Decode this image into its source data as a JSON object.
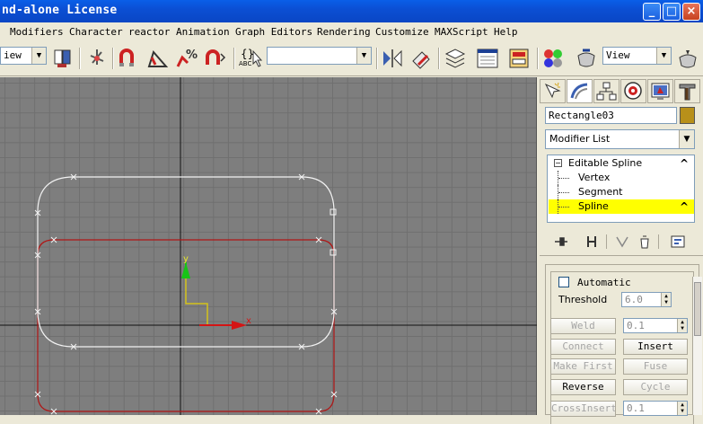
{
  "title_bar": {
    "title": "nd-alone License",
    "minimize_glyph": "_",
    "maximize_glyph": "□",
    "close_glyph": "×"
  },
  "menu": {
    "items": [
      "Modifiers",
      "Character",
      "reactor",
      "Animation",
      "Graph Editors",
      "Rendering",
      "Customize",
      "MAXScript",
      "Help"
    ]
  },
  "toolbar": {
    "view_dropdown_left": "iew",
    "selection_set_value": "",
    "view_dropdown_right": "View",
    "snap_label": "3",
    "named_sel_label": "{}",
    "named_sel_sub": "ABC"
  },
  "viewport": {
    "axis_x_label": "x",
    "axis_y_label": "y",
    "colors": {
      "background": "#7e7e7e",
      "grid": "#6f6f6f",
      "white_shape": "#f2f2f2",
      "red_shape": "#b01515",
      "axis_x": "#d41414",
      "axis_y": "#17c417",
      "gizmo": "#d4c21a"
    }
  },
  "command_panel": {
    "tabs": [
      "create-icon",
      "modify-icon",
      "hierarchy-icon",
      "motion-icon",
      "display-icon",
      "utilities-icon"
    ],
    "object_name": "Rectangle03",
    "object_color": "#b8901a",
    "modifier_list": "Modifier List",
    "stack": [
      {
        "label": "Editable Spline",
        "toggle": "−",
        "chevron": "^"
      },
      {
        "label": "Vertex"
      },
      {
        "label": "Segment"
      },
      {
        "label": "Spline",
        "selected": true,
        "chevron": "^"
      }
    ],
    "rollout": {
      "automatic_label": "Automatic",
      "threshold_label": "Threshold",
      "threshold_value": "6.0",
      "weld_label": "Weld",
      "weld_value": "0.1",
      "connect_label": "Connect",
      "insert_label": "Insert",
      "make_first_label": "Make First",
      "fuse_label": "Fuse",
      "reverse_label": "Reverse",
      "cycle_label": "Cycle",
      "cross_insert_label": "CrossInsert",
      "cross_insert_value": "0.1"
    }
  }
}
